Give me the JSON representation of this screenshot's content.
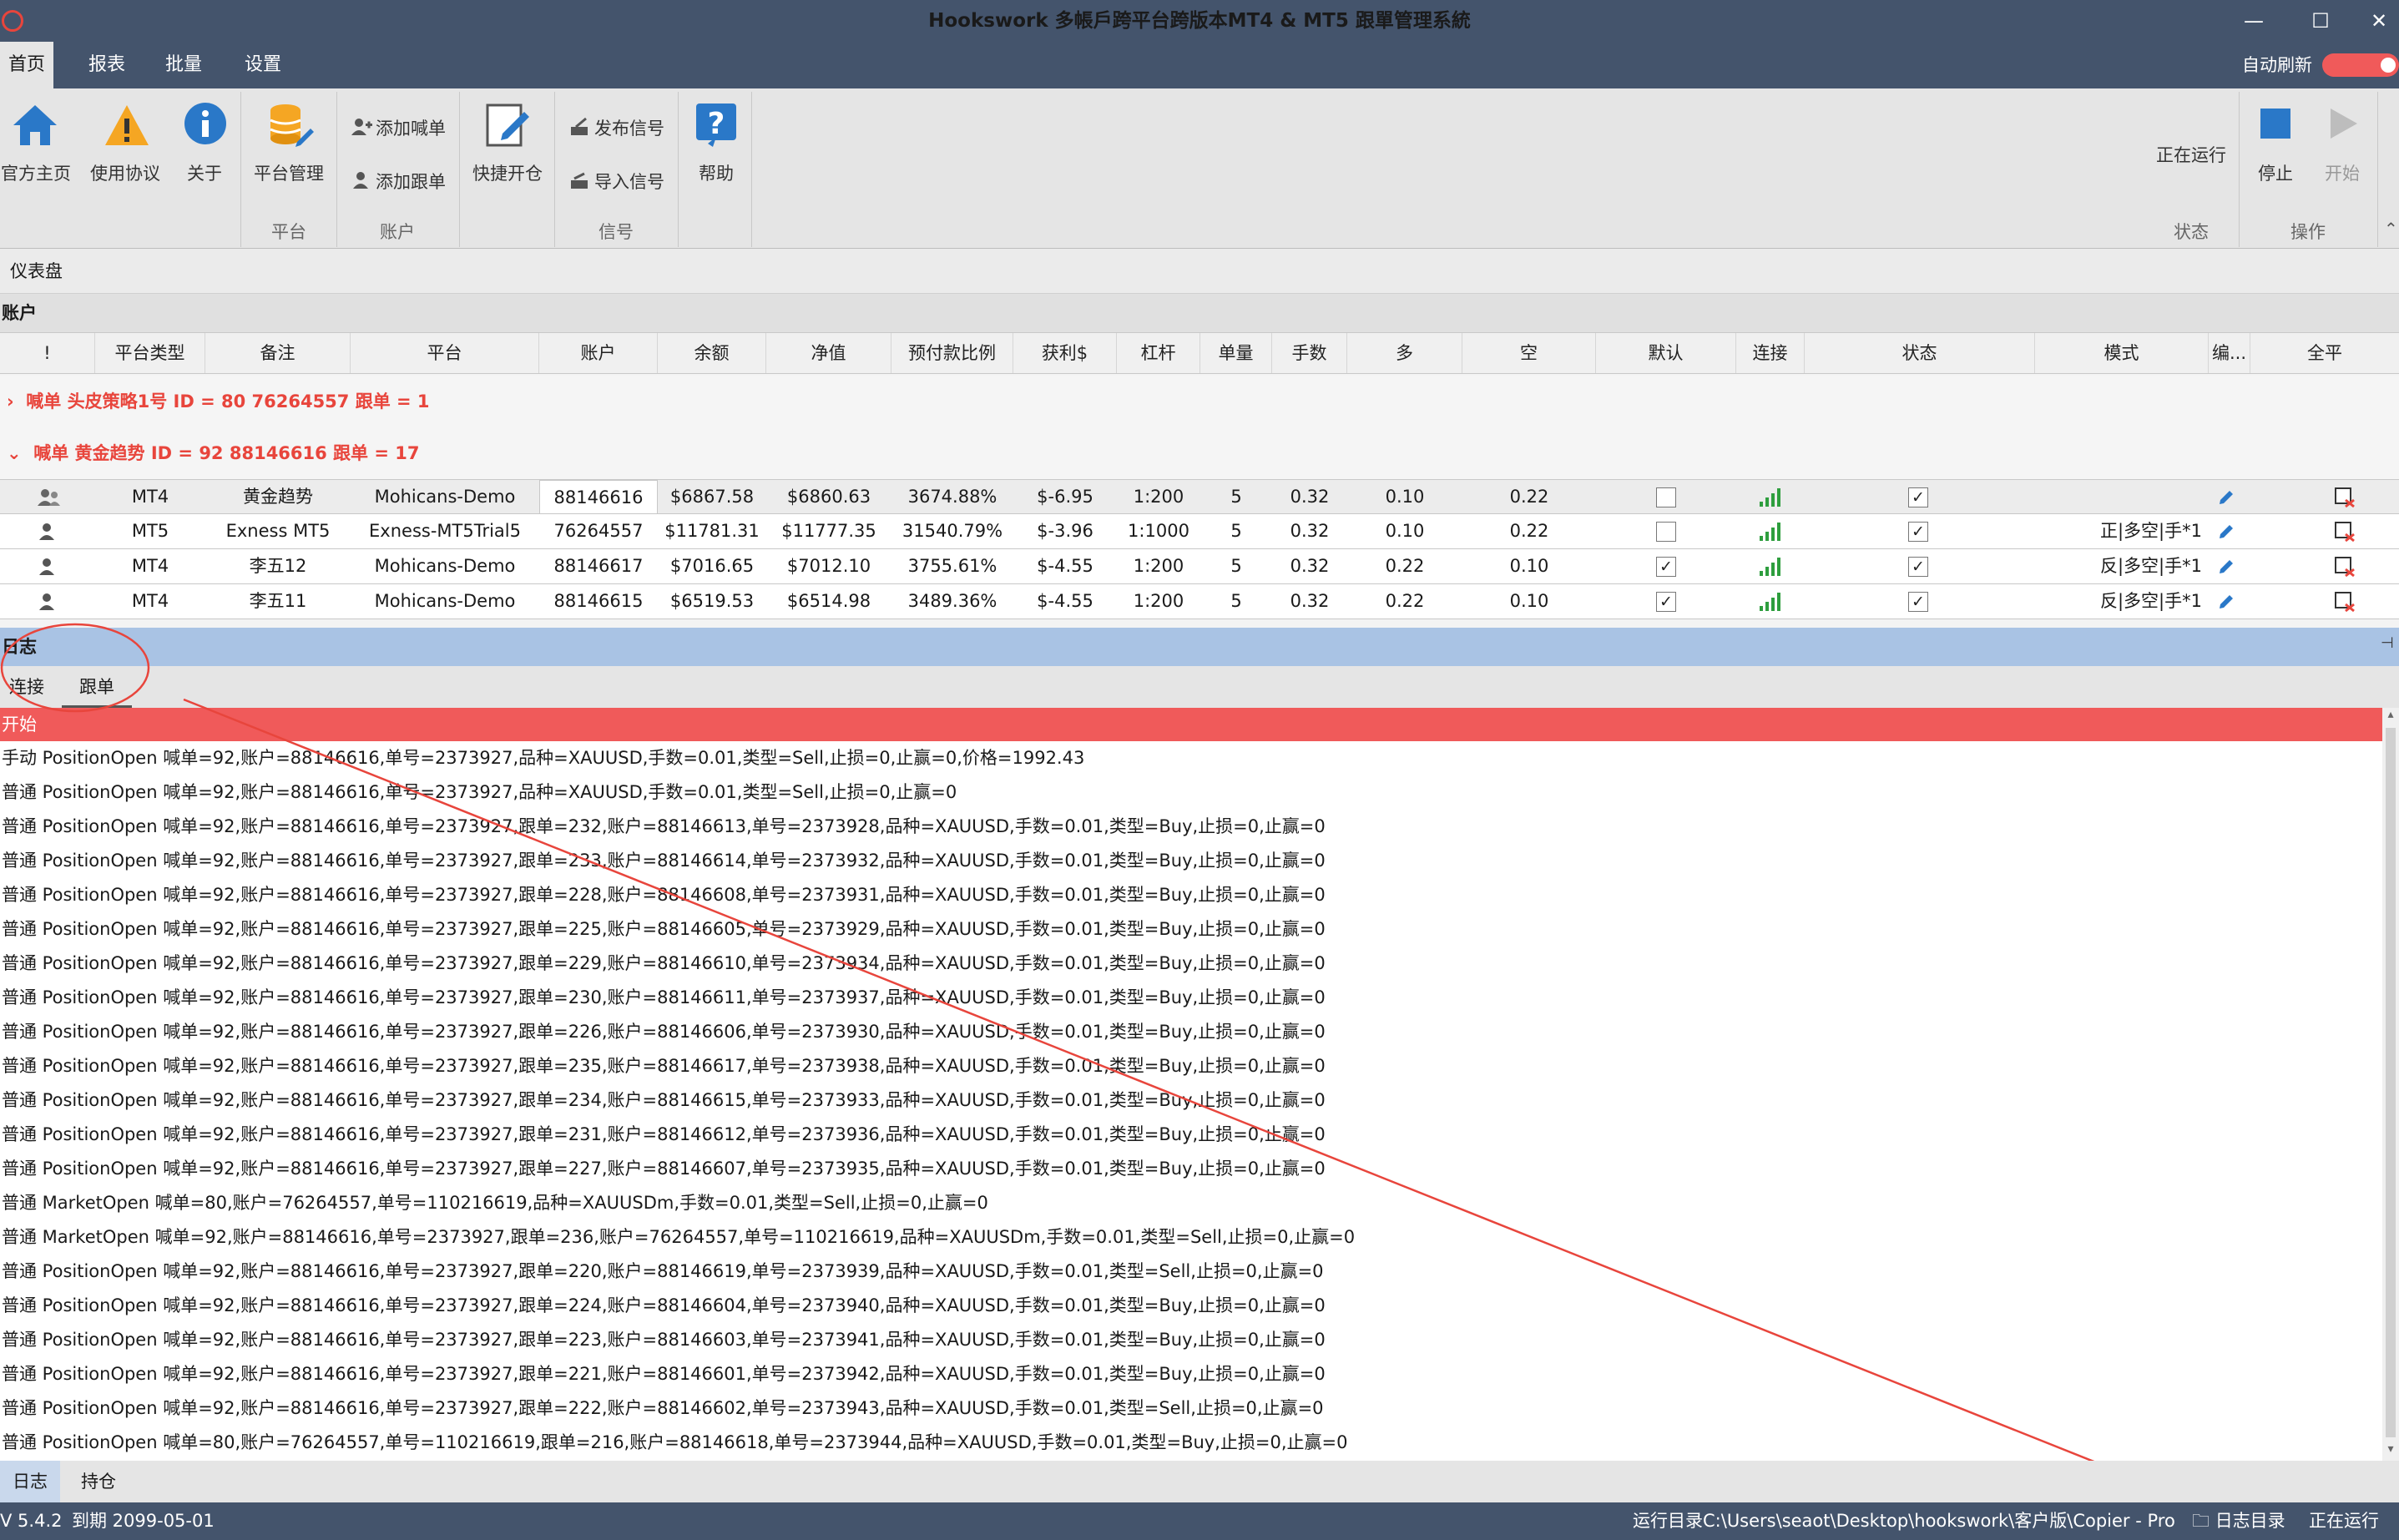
{
  "window": {
    "title": "Hookswork 多帳戶跨平台跨版本MT4 & MT5 跟單管理系統"
  },
  "menu": {
    "items": [
      "首页",
      "报表",
      "批量",
      "设置"
    ]
  },
  "auto_refresh": {
    "label": "自动刷新"
  },
  "ribbon": {
    "home": "官方主页",
    "agreement": "使用协议",
    "about": "关于",
    "platform_mgmt": "平台管理",
    "add_caller": "添加喊单",
    "add_follower": "添加跟单",
    "quick_open": "快捷开仓",
    "publish_signal": "发布信号",
    "import_signal": "导入信号",
    "help": "帮助",
    "running_status": "正在运行",
    "stop": "停止",
    "start": "开始",
    "group_platform": "平台",
    "group_account": "账户",
    "group_signal": "信号",
    "group_status": "状态",
    "group_action": "操作"
  },
  "dashboard": {
    "label": "仪表盘"
  },
  "accounts": {
    "header": "账户",
    "columns": [
      "!",
      "平台类型",
      "备注",
      "平台",
      "账户",
      "余额",
      "净值",
      "预付款比例",
      "获利$",
      "杠杆",
      "单量",
      "手数",
      "多",
      "空",
      "默认",
      "连接",
      "状态",
      "模式",
      "编...",
      "全平"
    ],
    "group1": "喊单  头皮策略1号 ID = 80 76264557  跟单 = 1",
    "group2": "喊单  黄金趋势 ID = 92 88146616  跟单 = 17",
    "rows": [
      {
        "type": "MT4",
        "note": "黄金趋势",
        "platform": "Mohicans-Demo",
        "account": "88146616",
        "balance": "$6867.58",
        "equity": "$6860.63",
        "margin": "3674.88%",
        "profit": "$-6.95",
        "leverage": "1:200",
        "orders": "5",
        "lots": "0.32",
        "long": "0.10",
        "short": "0.22",
        "default": false,
        "status": true,
        "mode": ""
      },
      {
        "type": "MT5",
        "note": "Exness MT5",
        "platform": "Exness-MT5Trial5",
        "account": "76264557",
        "balance": "$11781.31",
        "equity": "$11777.35",
        "margin": "31540.79%",
        "profit": "$-3.96",
        "leverage": "1:1000",
        "orders": "5",
        "lots": "0.32",
        "long": "0.10",
        "short": "0.22",
        "default": false,
        "status": true,
        "mode": "正|多空|手*1"
      },
      {
        "type": "MT4",
        "note": "李五12",
        "platform": "Mohicans-Demo",
        "account": "88146617",
        "balance": "$7016.65",
        "equity": "$7012.10",
        "margin": "3755.61%",
        "profit": "$-4.55",
        "leverage": "1:200",
        "orders": "5",
        "lots": "0.32",
        "long": "0.22",
        "short": "0.10",
        "default": true,
        "status": true,
        "mode": "反|多空|手*1"
      },
      {
        "type": "MT4",
        "note": "李五11",
        "platform": "Mohicans-Demo",
        "account": "88146615",
        "balance": "$6519.53",
        "equity": "$6514.98",
        "margin": "3489.36%",
        "profit": "$-4.55",
        "leverage": "1:200",
        "orders": "5",
        "lots": "0.32",
        "long": "0.22",
        "short": "0.10",
        "default": true,
        "status": true,
        "mode": "反|多空|手*1"
      }
    ]
  },
  "log": {
    "header": "日志",
    "tabs": [
      "连接",
      "跟单"
    ],
    "start": "开始",
    "lines": [
      "手动 PositionOpen 喊单=92,账户=88146616,单号=2373927,品种=XAUUSD,手数=0.01,类型=Sell,止损=0,止赢=0,价格=1992.43",
      "普通 PositionOpen 喊单=92,账户=88146616,单号=2373927,品种=XAUUSD,手数=0.01,类型=Sell,止损=0,止赢=0",
      "普通 PositionOpen 喊单=92,账户=88146616,单号=2373927,跟单=232,账户=88146613,单号=2373928,品种=XAUUSD,手数=0.01,类型=Buy,止损=0,止赢=0",
      "普通 PositionOpen 喊单=92,账户=88146616,单号=2373927,跟单=233,账户=88146614,单号=2373932,品种=XAUUSD,手数=0.01,类型=Buy,止损=0,止赢=0",
      "普通 PositionOpen 喊单=92,账户=88146616,单号=2373927,跟单=228,账户=88146608,单号=2373931,品种=XAUUSD,手数=0.01,类型=Buy,止损=0,止赢=0",
      "普通 PositionOpen 喊单=92,账户=88146616,单号=2373927,跟单=225,账户=88146605,单号=2373929,品种=XAUUSD,手数=0.01,类型=Buy,止损=0,止赢=0",
      "普通 PositionOpen 喊单=92,账户=88146616,单号=2373927,跟单=229,账户=88146610,单号=2373934,品种=XAUUSD,手数=0.01,类型=Buy,止损=0,止赢=0",
      "普通 PositionOpen 喊单=92,账户=88146616,单号=2373927,跟单=230,账户=88146611,单号=2373937,品种=XAUUSD,手数=0.01,类型=Buy,止损=0,止赢=0",
      "普通 PositionOpen 喊单=92,账户=88146616,单号=2373927,跟单=226,账户=88146606,单号=2373930,品种=XAUUSD,手数=0.01,类型=Buy,止损=0,止赢=0",
      "普通 PositionOpen 喊单=92,账户=88146616,单号=2373927,跟单=235,账户=88146617,单号=2373938,品种=XAUUSD,手数=0.01,类型=Buy,止损=0,止赢=0",
      "普通 PositionOpen 喊单=92,账户=88146616,单号=2373927,跟单=234,账户=88146615,单号=2373933,品种=XAUUSD,手数=0.01,类型=Buy,止损=0,止赢=0",
      "普通 PositionOpen 喊单=92,账户=88146616,单号=2373927,跟单=231,账户=88146612,单号=2373936,品种=XAUUSD,手数=0.01,类型=Buy,止损=0,止赢=0",
      "普通 PositionOpen 喊单=92,账户=88146616,单号=2373927,跟单=227,账户=88146607,单号=2373935,品种=XAUUSD,手数=0.01,类型=Buy,止损=0,止赢=0",
      "普通 MarketOpen 喊单=80,账户=76264557,单号=110216619,品种=XAUUSDm,手数=0.01,类型=Sell,止损=0,止赢=0",
      "普通 MarketOpen 喊单=92,账户=88146616,单号=2373927,跟单=236,账户=76264557,单号=110216619,品种=XAUUSDm,手数=0.01,类型=Sell,止损=0,止赢=0",
      "普通 PositionOpen 喊单=92,账户=88146616,单号=2373927,跟单=220,账户=88146619,单号=2373939,品种=XAUUSD,手数=0.01,类型=Sell,止损=0,止赢=0",
      "普通 PositionOpen 喊单=92,账户=88146616,单号=2373927,跟单=224,账户=88146604,单号=2373940,品种=XAUUSD,手数=0.01,类型=Buy,止损=0,止赢=0",
      "普通 PositionOpen 喊单=92,账户=88146616,单号=2373927,跟单=223,账户=88146603,单号=2373941,品种=XAUUSD,手数=0.01,类型=Buy,止损=0,止赢=0",
      "普通 PositionOpen 喊单=92,账户=88146616,单号=2373927,跟单=221,账户=88146601,单号=2373942,品种=XAUUSD,手数=0.01,类型=Buy,止损=0,止赢=0",
      "普通 PositionOpen 喊单=92,账户=88146616,单号=2373927,跟单=222,账户=88146602,单号=2373943,品种=XAUUSD,手数=0.01,类型=Sell,止损=0,止赢=0",
      "普通 PositionOpen 喊单=80,账户=76264557,单号=110216619,跟单=216,账户=88146618,单号=2373944,品种=XAUUSD,手数=0.01,类型=Buy,止损=0,止赢=0"
    ]
  },
  "bottom_tabs": [
    "日志",
    "持仓"
  ],
  "status": {
    "version": "V 5.4.2",
    "expiry": "到期 2099-05-01",
    "run_dir": "运行目录C:\\Users\\seaot\\Desktop\\hookswork\\客户版\\Copier - Pro",
    "log_dir": "日志目录",
    "running": "正在运行"
  },
  "colors": {
    "titlebar": "#44546c",
    "accent_red": "#e8453c",
    "log_header": "#a9c3e4",
    "start_bar": "#f05a5a"
  },
  "icons": [
    "home-icon",
    "warning-icon",
    "info-icon",
    "database-icon",
    "add-user-icon",
    "user-icon",
    "edit-icon",
    "signal-send-icon",
    "signal-import-icon",
    "help-icon",
    "stop-icon",
    "play-icon",
    "signal-bars-icon",
    "pencil-icon",
    "close-all-icon",
    "folder-icon"
  ]
}
